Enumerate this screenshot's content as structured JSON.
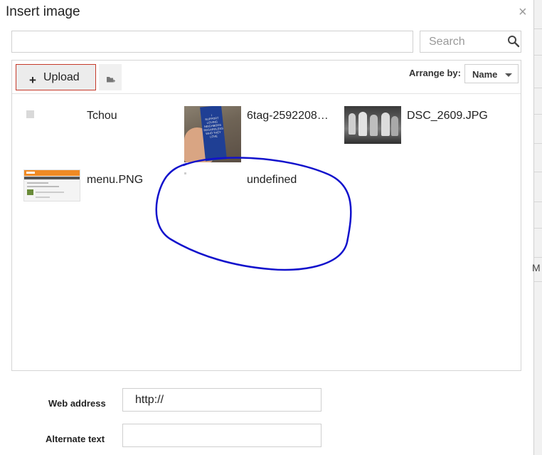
{
  "dialog": {
    "title": "Insert image",
    "close_label": "×"
  },
  "search": {
    "placeholder": "Search"
  },
  "toolbar": {
    "upload_label": "Upload",
    "upload_prefix": "+",
    "arrange_label": "Arrange by:",
    "arrange_value": "Name"
  },
  "items": [
    {
      "name": "Tchou"
    },
    {
      "name": "6tag-2592208…"
    },
    {
      "name": "DSC_2609.JPG"
    },
    {
      "name": "menu.PNG"
    },
    {
      "name": "undefined"
    }
  ],
  "thumbnail_texts": {
    "ribbon": [
      "I",
      "SUPPORT",
      "LOVING",
      "NEIGHBORS",
      "REGARDLESS",
      "WHO THEY",
      "LOVE"
    ]
  },
  "form": {
    "web_address_label": "Web address",
    "web_address_value": "http://",
    "alt_text_label": "Alternate text",
    "alt_text_value": ""
  },
  "background": {
    "peek_text": "M"
  },
  "colors": {
    "upload_border": "#c53929",
    "annotation_stroke": "#1111cc"
  }
}
